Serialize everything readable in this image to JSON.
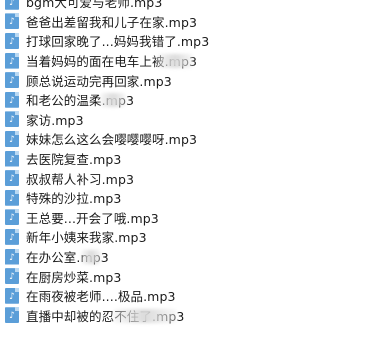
{
  "icon": "audio-file-icon",
  "files": [
    "bgm大可爱与老师.mp3",
    "爸爸出差留我和儿子在家.mp3",
    "打球回家晚了...妈妈我错了.mp3",
    "当着妈妈的面在电车上被.mp3",
    "顾总说运动完再回家.mp3",
    "和老公的温柔.mp3",
    "家访.mp3",
    "妹妹怎么这么会嘤嘤嘤呀.mp3",
    "去医院复查.mp3",
    "叔叔帮人补习.mp3",
    "特殊的沙拉.mp3",
    "王总要...开会了哦.mp3",
    "新年小姨来我家.mp3",
    "在办公室.mp3",
    "在厨房炒菜.mp3",
    "在雨夜被老师....极品.mp3",
    "直播中却被的忍不住了.mp3"
  ]
}
